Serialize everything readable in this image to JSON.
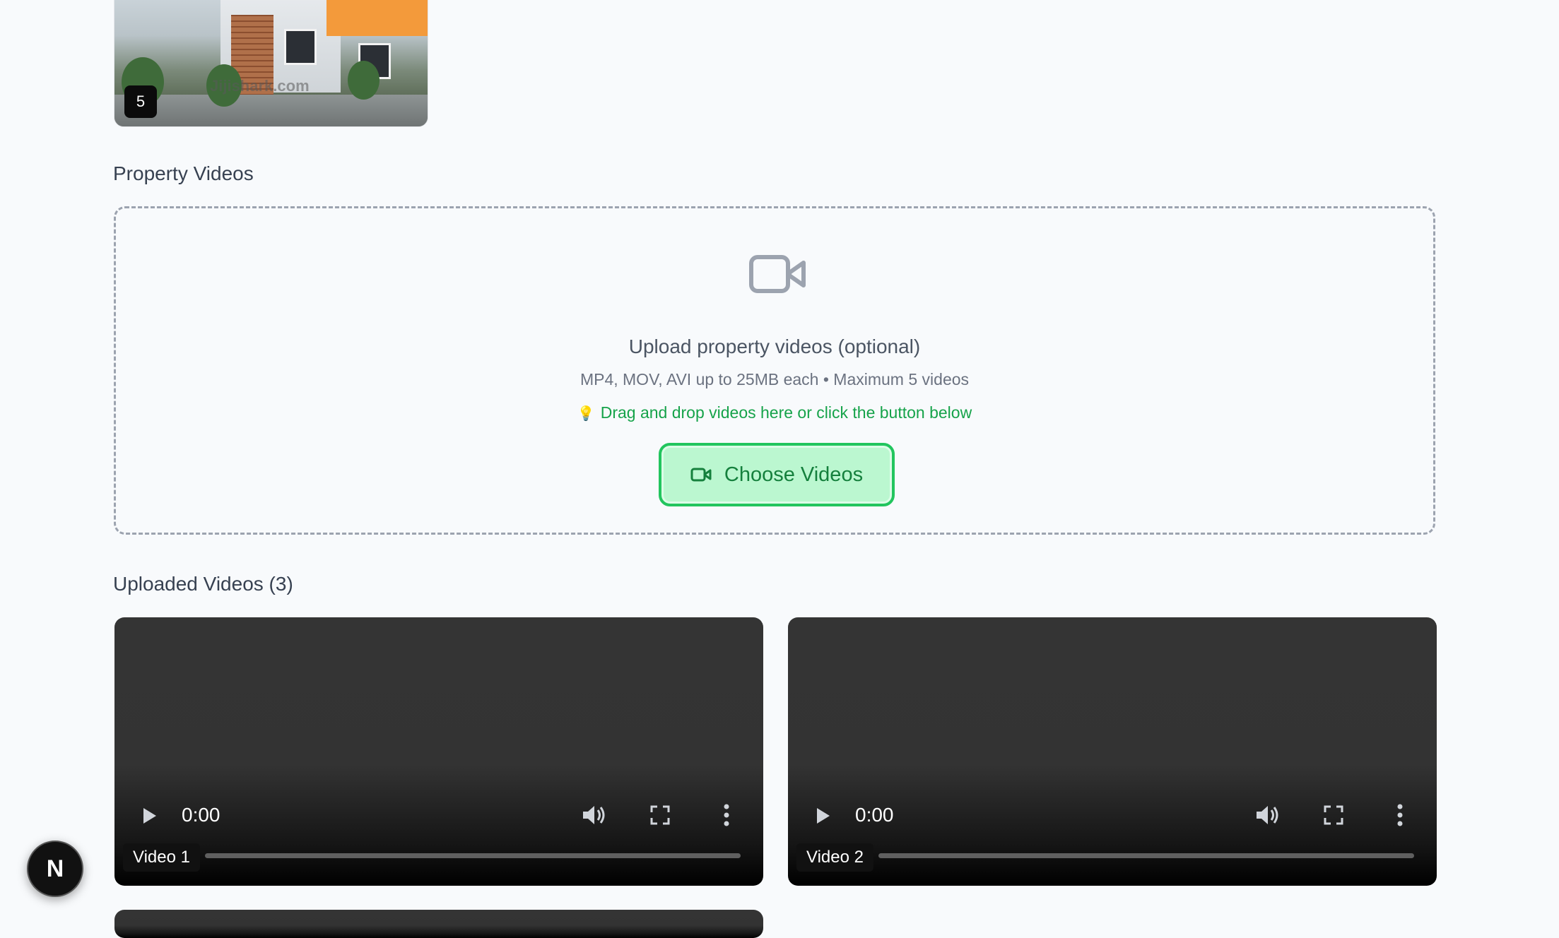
{
  "thumbnail": {
    "index_badge": "5",
    "watermark": "Jijishark.com"
  },
  "videos_section": {
    "title": "Property Videos"
  },
  "dropzone": {
    "icon": "video-camera-icon",
    "title": "Upload property videos (optional)",
    "subtitle": "MP4, MOV, AVI up to 25MB each • Maximum 5 videos",
    "hint_icon": "lightbulb-icon",
    "hint": "Drag and drop videos here or click the button below",
    "button_label": "Choose Videos",
    "accent": "#16a34a"
  },
  "uploaded": {
    "title": "Uploaded Videos (3)",
    "videos": [
      {
        "label": "Video 1",
        "time": "0:00",
        "progress": 0
      },
      {
        "label": "Video 2",
        "time": "0:00",
        "progress": 0
      }
    ]
  },
  "dev_badge": {
    "label": "N"
  }
}
